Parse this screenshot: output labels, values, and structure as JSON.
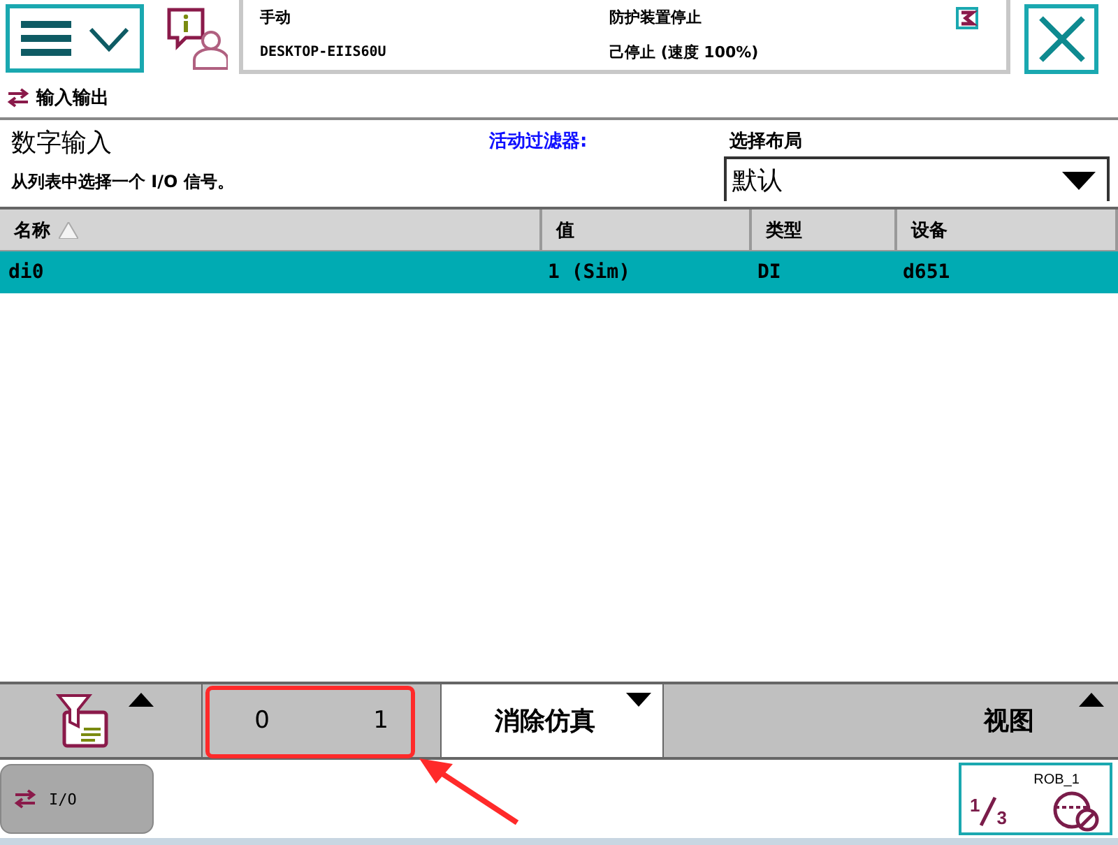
{
  "status": {
    "mode": "手动",
    "controller": "DESKTOP-EIIS60U",
    "safety": "防护装置停止",
    "run_state": "己停止 (速度 100%)"
  },
  "breadcrumb": "输入输出",
  "view": {
    "title": "数字输入",
    "instruction": "从列表中选择一个 I/O 信号。",
    "filter_label": "活动过滤器:",
    "layout_label": "选择布局",
    "layout_value": "默认"
  },
  "table": {
    "columns": [
      {
        "label": "名称",
        "sorted": true
      },
      {
        "label": "值",
        "sorted": false
      },
      {
        "label": "类型",
        "sorted": false
      },
      {
        "label": "设备",
        "sorted": false
      }
    ],
    "rows": [
      {
        "cells": [
          "di0",
          "1 (Sim)",
          "DI",
          "d651"
        ],
        "selected": true
      }
    ]
  },
  "toolbar": {
    "value_buttons": [
      "0",
      "1"
    ],
    "clear_sim": "消除仿真",
    "view": "视图"
  },
  "taskbar": [
    {
      "label": "I/O",
      "selected": true
    }
  ],
  "quickset": {
    "unit": "ROB_1",
    "numerator": "1",
    "denominator": "3"
  }
}
